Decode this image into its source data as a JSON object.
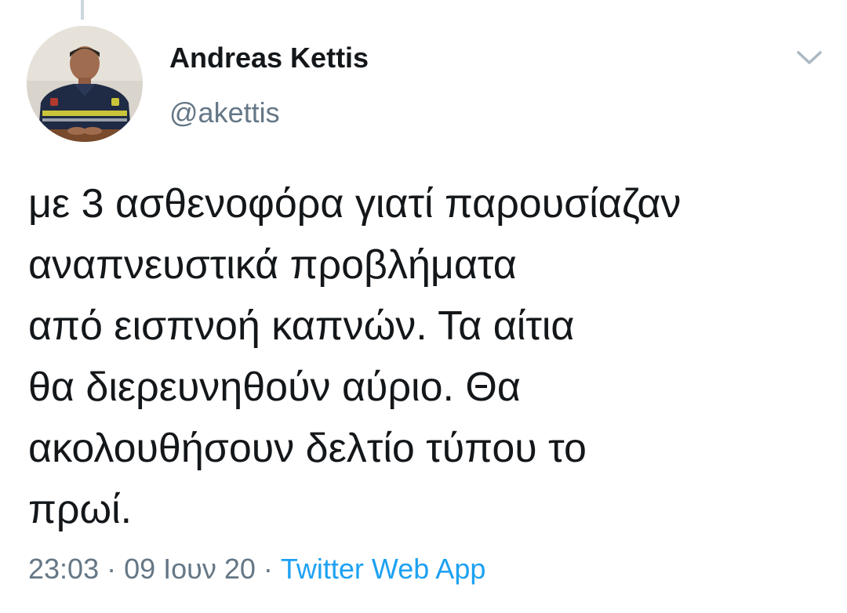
{
  "author": {
    "display_name": "Andreas Kettis",
    "handle": "@akettis",
    "avatar_icon": "profile-photo"
  },
  "tweet": {
    "lines": [
      "με 3 ασθενοφόρα γιατί παρουσίαζαν",
      "αναπνευστικά προβλήματα",
      "από εισπνοή καπνών. Τα αίτια",
      "θα διερευνηθούν αύριο. Θα",
      "ακολουθήσουν δελτίο τύπου το",
      "πρωί."
    ]
  },
  "meta": {
    "time": "23:03",
    "separator": " · ",
    "date": "09 Ιουν 20",
    "source": "Twitter Web App"
  },
  "colors": {
    "text": "#14171a",
    "secondary": "#657786",
    "link": "#1da1f2",
    "thread_line": "#ccd6dd",
    "chevron": "#aab8c2"
  },
  "icons": {
    "menu": "chevron-down-icon"
  }
}
